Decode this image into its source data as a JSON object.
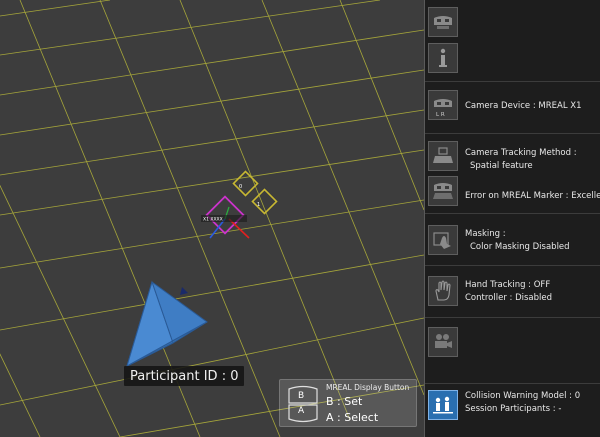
{
  "viewport": {
    "participant_label": "Participant ID : 0",
    "marker_labels": [
      "0",
      "1",
      "X1 XXXX"
    ]
  },
  "display_button": {
    "title": "MREAL Display Button",
    "b_key": "B",
    "a_key": "A",
    "b_action": "B : Set",
    "a_action": "A : Select"
  },
  "panel": {
    "camera_device": "Camera Device : MREAL X1",
    "camera_device_icon_sub": "L  R",
    "tracking_method_label": "Camera Tracking Method :",
    "tracking_method_value": "Spatial feature",
    "marker_error": "Error on MREAL Marker : Excellent",
    "masking_label": "Masking :",
    "masking_value": "Color Masking Disabled",
    "hand_tracking": "Hand Tracking : OFF",
    "controller": "Controller : Disabled",
    "collision_model": "Collision Warning Model : 0",
    "session_participants": "Session Participants : -"
  },
  "colors": {
    "grid": "#b8b83a",
    "accent": "#2a6fb0",
    "avatar": "#3f7dc4",
    "marker_yellow": "#c8b832",
    "marker_magenta": "#cc33cc"
  },
  "icons": [
    "camera-icon",
    "info-icon",
    "tracking-icon",
    "marker-camera-icon",
    "masking-icon",
    "hand-icon",
    "video-camera-icon",
    "collision-icon"
  ]
}
